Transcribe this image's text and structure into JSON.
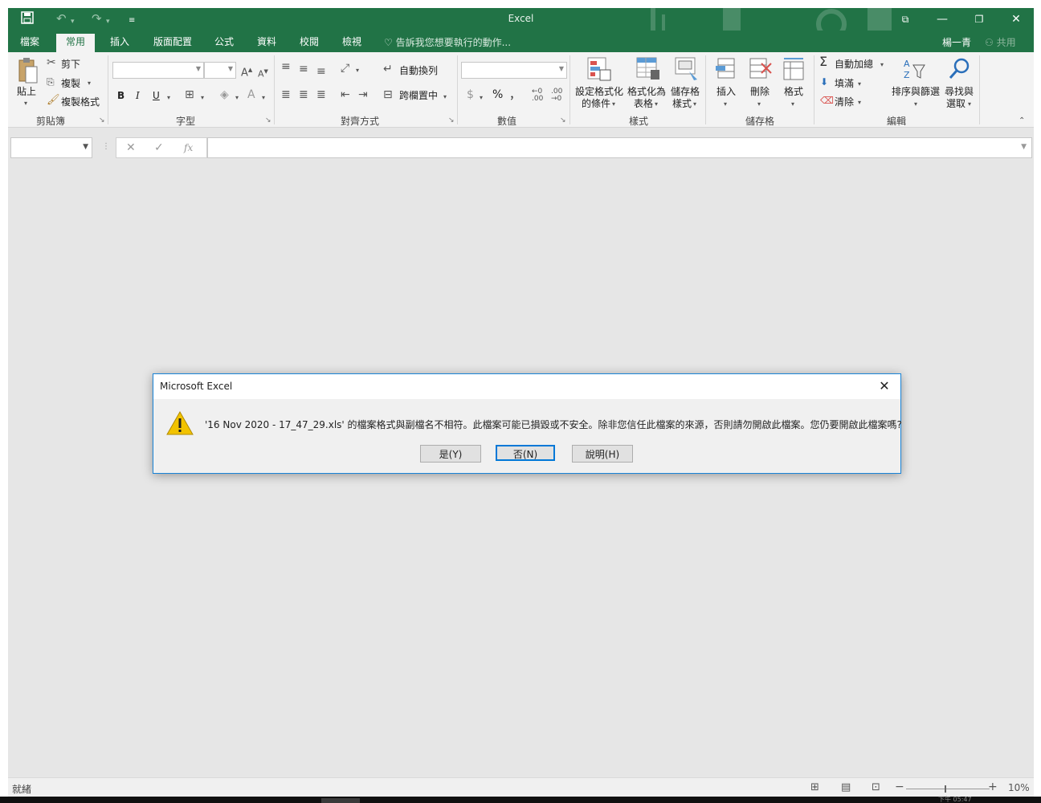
{
  "window": {
    "app_title": "Excel",
    "user_name": "楊一青",
    "share_label": "共用"
  },
  "tabs": [
    {
      "label": "檔案"
    },
    {
      "label": "常用",
      "active": true
    },
    {
      "label": "插入"
    },
    {
      "label": "版面配置"
    },
    {
      "label": "公式"
    },
    {
      "label": "資料"
    },
    {
      "label": "校閱"
    },
    {
      "label": "檢視"
    }
  ],
  "tell_me": "告訴我您想要執行的動作...",
  "ribbon": {
    "clipboard": {
      "group": "剪貼簿",
      "paste": "貼上",
      "cut": "剪下",
      "copy": "複製",
      "format_painter": "複製格式"
    },
    "font": {
      "group": "字型",
      "bold": "B",
      "italic": "I",
      "underline": "U"
    },
    "alignment": {
      "group": "對齊方式",
      "wrap_text": "自動換列",
      "merge_center": "跨欄置中"
    },
    "number": {
      "group": "數值",
      "currency": "$",
      "percent": "%",
      "comma": "，"
    },
    "styles": {
      "group": "樣式",
      "cond_format_1": "設定格式化",
      "cond_format_2": "的條件",
      "format_table_1": "格式化為",
      "format_table_2": "表格",
      "cell_styles_1": "儲存格",
      "cell_styles_2": "樣式"
    },
    "cells": {
      "group": "儲存格",
      "insert": "插入",
      "delete": "刪除",
      "format": "格式"
    },
    "editing": {
      "group": "編輯",
      "autosum": "自動加總",
      "fill": "填滿",
      "clear": "清除",
      "sort_filter": "排序與篩選",
      "find_1": "尋找與",
      "find_2": "選取"
    }
  },
  "formula_bar": {
    "fx_label": "fx",
    "name_box_value": "",
    "formula_value": ""
  },
  "status": {
    "ready": "就緒",
    "zoom": "10%"
  },
  "dialog": {
    "title": "Microsoft Excel",
    "message": "'16 Nov 2020 - 17_47_29.xls' 的檔案格式與副檔名不相符。此檔案可能已損毀或不安全。除非您信任此檔案的來源，否則請勿開啟此檔案。您仍要開啟此檔案嗎?",
    "yes": "是(Y)",
    "no": "否(N)",
    "help": "說明(H)"
  },
  "taskbar": {
    "clock": "下午 05:47"
  },
  "colors": {
    "accent": "#217346",
    "dialog_border": "#1883d7",
    "default_button": "#0078d7",
    "warning": "#f2c300"
  }
}
